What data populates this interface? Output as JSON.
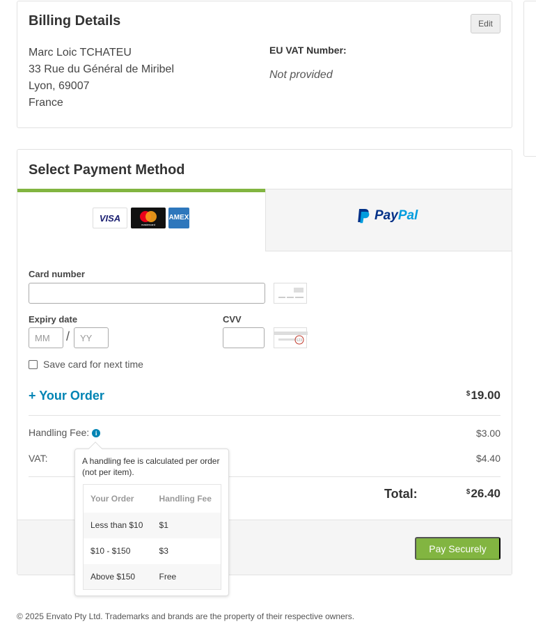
{
  "billing": {
    "title": "Billing Details",
    "edit_label": "Edit",
    "address_lines": [
      "Marc Loic TCHATEU",
      "33 Rue du Général de Miribel",
      "Lyon, 69007",
      "France"
    ],
    "vat_label": "EU VAT Number:",
    "vat_value": "Not provided"
  },
  "payment": {
    "title": "Select Payment Method",
    "tabs": {
      "card_brands": [
        "VISA",
        "mastercard",
        "AMEX"
      ],
      "paypal_label_a": "Pay",
      "paypal_label_b": "Pal",
      "active": "card"
    },
    "card_number_label": "Card number",
    "expiry_label": "Expiry date",
    "expiry_month_placeholder": "MM",
    "expiry_year_placeholder": "YY",
    "expiry_separator": "/",
    "cvv_label": "CVV",
    "save_card_label": "Save card for next time",
    "save_card_checked": false,
    "order_toggle": "+ Your Order",
    "order_currency": "$",
    "order_amount": "19.00",
    "handling_fee_label": "Handling Fee:",
    "handling_fee_value": "$3.00",
    "vat_label": "VAT:",
    "vat_value": "$4.40",
    "total_label": "Total:",
    "total_currency": "$",
    "total_amount": "26.40",
    "pay_button": "Pay Securely"
  },
  "tooltip": {
    "text": "A handling fee is calculated per order (not per item).",
    "headers": [
      "Your Order",
      "Handling Fee"
    ],
    "rows": [
      [
        "Less than $10",
        "$1"
      ],
      [
        "$10 - $150",
        "$3"
      ],
      [
        "Above $150",
        "Free"
      ]
    ]
  },
  "footer": {
    "copyright": "© 2025 Envato Pty Ltd. Trademarks and brands are the property of their respective owners."
  },
  "colors": {
    "accent_green": "#82b541",
    "link_blue": "#0084b4",
    "paypal_dark": "#003087",
    "paypal_light": "#009cde"
  }
}
